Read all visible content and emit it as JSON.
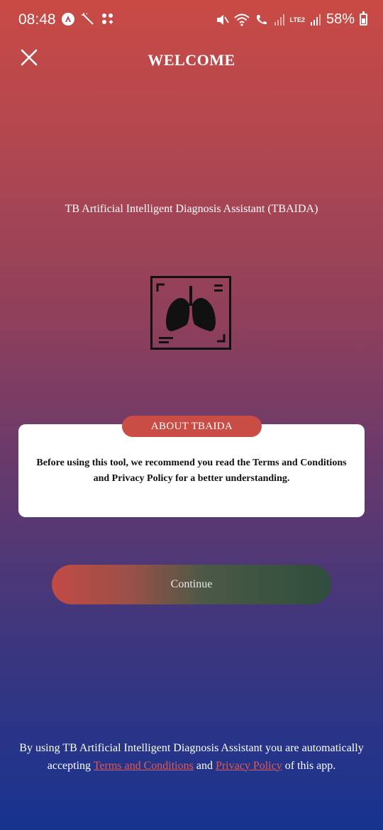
{
  "status_bar": {
    "time": "08:48",
    "battery": "58%",
    "network": "LTE2"
  },
  "header": {
    "title": "WELCOME",
    "close_icon": "close-icon"
  },
  "app": {
    "subtitle": "TB Artificial Intelligent Diagnosis Assistant (TBAIDA)",
    "logo_icon": "lungs-xray-icon"
  },
  "about": {
    "pill_label": "ABOUT TBAIDA",
    "text": "Before using this tool, we recommend you read the Terms and Conditions and Privacy Policy for a better understanding."
  },
  "actions": {
    "continue_label": "Continue"
  },
  "footer": {
    "prefix": "By using TB Artificial Intelligent Diagnosis Assistant you are automatically accepting",
    "terms_label": "Terms and Conditions",
    "and_text": "and",
    "privacy_label": "Privacy Policy",
    "suffix": "of this app."
  },
  "colors": {
    "accent": "#c94c45",
    "link": "#e25a52",
    "card": "#ffffff"
  }
}
